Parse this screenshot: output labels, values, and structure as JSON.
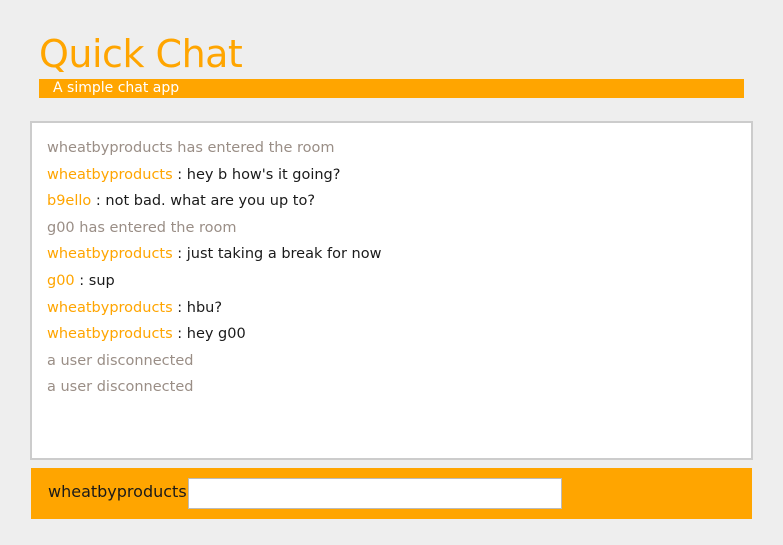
{
  "header": {
    "title": "Quick Chat",
    "subtitle": "A simple chat app"
  },
  "messages": [
    {
      "type": "system",
      "text": "wheatbyproducts has entered the room"
    },
    {
      "type": "chat",
      "user": "wheatbyproducts",
      "text": " : hey b how's it going?"
    },
    {
      "type": "chat",
      "user": "b9ello",
      "text": " : not bad. what are you up to?"
    },
    {
      "type": "system",
      "text": "g00 has entered the room"
    },
    {
      "type": "chat",
      "user": "wheatbyproducts",
      "text": " : just taking a break for now"
    },
    {
      "type": "chat",
      "user": "g00",
      "text": " : sup"
    },
    {
      "type": "chat",
      "user": "wheatbyproducts",
      "text": " : hbu?"
    },
    {
      "type": "chat",
      "user": "wheatbyproducts",
      "text": " : hey g00"
    },
    {
      "type": "system",
      "text": "a user disconnected"
    },
    {
      "type": "system",
      "text": "a user disconnected"
    }
  ],
  "input": {
    "username": "wheatbyproducts",
    "value": "",
    "placeholder": ""
  },
  "colors": {
    "accent": "#ffa500",
    "background": "#eeeeee",
    "system_text": "#9a8e86"
  }
}
